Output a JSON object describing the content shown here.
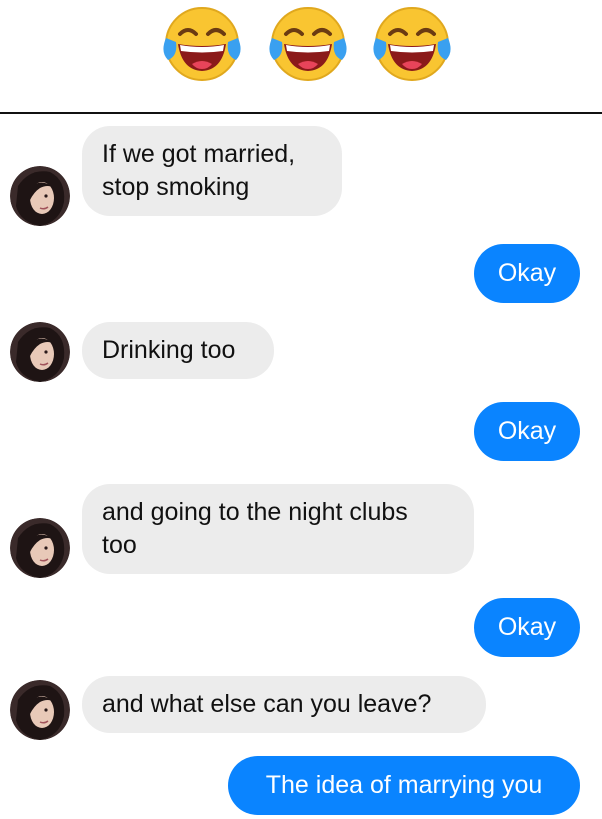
{
  "header": {
    "emojis": [
      "face-with-tears-of-joy",
      "face-with-tears-of-joy",
      "face-with-tears-of-joy"
    ]
  },
  "colors": {
    "sent_bubble": "#0a84ff",
    "received_bubble": "#ececec",
    "divider": "#111111"
  },
  "messages": [
    {
      "side": "received",
      "text": "If we got married,\nstop smoking"
    },
    {
      "side": "sent",
      "text": "Okay"
    },
    {
      "side": "received",
      "text": "Drinking too"
    },
    {
      "side": "sent",
      "text": "Okay"
    },
    {
      "side": "received",
      "text": "and going to the night clubs\ntoo"
    },
    {
      "side": "sent",
      "text": "Okay"
    },
    {
      "side": "received",
      "text": "and what else can you leave?"
    },
    {
      "side": "sent",
      "text": "The idea of marrying you"
    }
  ]
}
